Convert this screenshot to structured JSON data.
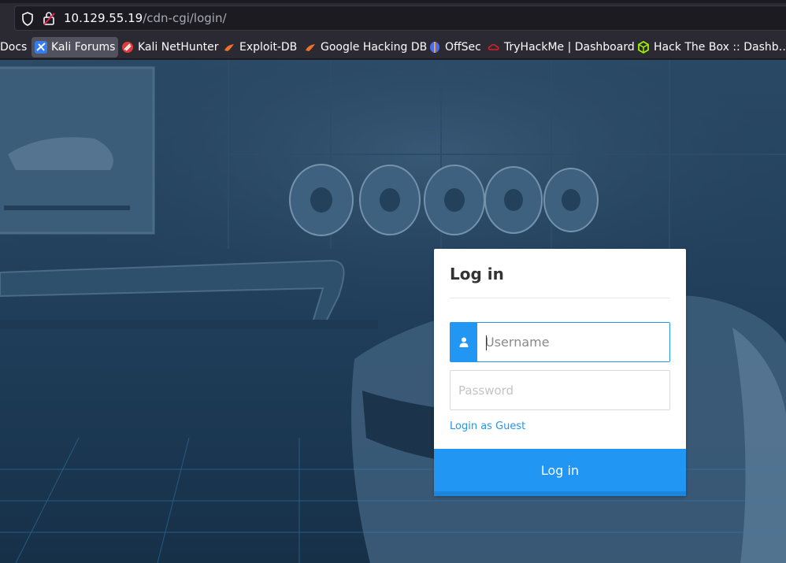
{
  "browser": {
    "url_host": "10.129.55.19",
    "url_path": "/cdn-cgi/login/",
    "icons": {
      "shield": "tracking-protection-icon",
      "lock": "insecure-lock-icon"
    }
  },
  "bookmarks": [
    {
      "label": "Docs",
      "icon": "none"
    },
    {
      "label": "Kali Forums",
      "icon": "kali-forums-icon"
    },
    {
      "label": "Kali NetHunter",
      "icon": "kali-nethunter-icon"
    },
    {
      "label": "Exploit-DB",
      "icon": "exploit-db-icon"
    },
    {
      "label": "Google Hacking DB",
      "icon": "ghdb-icon"
    },
    {
      "label": "OffSec",
      "icon": "offsec-icon"
    },
    {
      "label": "TryHackMe | Dashboard",
      "icon": "tryhackme-icon"
    },
    {
      "label": "Hack The Box :: Dashb…",
      "icon": "hackthebox-icon"
    }
  ],
  "login": {
    "title": "Log in",
    "username_placeholder": "Username",
    "password_placeholder": "Password",
    "guest_link": "Login as Guest",
    "submit_label": "Log in"
  },
  "colors": {
    "accent": "#2196f3",
    "page_overlay": "#1f3b55",
    "chrome_bg": "#2b2a33"
  }
}
